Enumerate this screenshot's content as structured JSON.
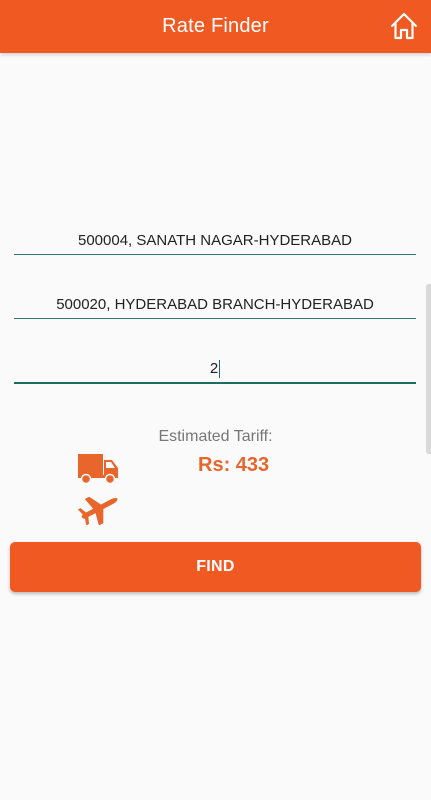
{
  "header": {
    "title": "Rate Finder",
    "home_icon": "home-icon"
  },
  "form": {
    "origin": "500004, SANATH NAGAR-HYDERABAD",
    "destination": "500020, HYDERABAD BRANCH-HYDERABAD",
    "weight": "2"
  },
  "result": {
    "label": "Estimated Tariff:",
    "value": "Rs: 433"
  },
  "modes": {
    "road_icon": "truck-icon",
    "air_icon": "airplane-icon"
  },
  "actions": {
    "find_label": "FIND"
  },
  "colors": {
    "primary": "#f05a22",
    "underline": "#2d7a6e",
    "tariff": "#e8652c"
  }
}
